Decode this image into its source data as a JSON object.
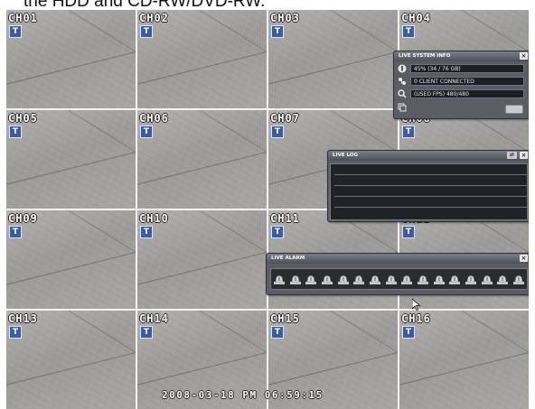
{
  "caption": "the HDD  and  CD-RW/DVD-RW.",
  "channels": [
    "CH01",
    "CH02",
    "CH03",
    "CH04",
    "CH05",
    "CH06",
    "CH07",
    "CH08",
    "CH09",
    "CH10",
    "CH11",
    "CH12",
    "CH13",
    "CH14",
    "CH15",
    "CH16"
  ],
  "channel_badge": "T",
  "live_system_info": {
    "title": "LIVE SYSTEM INFO",
    "close": "×",
    "rows": [
      {
        "icon": "hdd-info-icon",
        "value": "45% (34 / 76 GB)"
      },
      {
        "icon": "network-client-icon",
        "value": "0 CLIENT CONNECTED"
      },
      {
        "icon": "fps-search-icon",
        "value": "(USED FPS) 480/480"
      },
      {
        "icon": "backup-icon",
        "value": ""
      }
    ]
  },
  "live_log": {
    "title": "LIVE LOG",
    "restore": "⇄",
    "close": "×"
  },
  "live_alarm": {
    "title": "LIVE ALARM",
    "close": "×",
    "alarm_count": 16
  },
  "timestamp": "2008-03-18 PM 06:59:15",
  "colors": {
    "panel_bg": "#5a5d63",
    "badge_blue": "#3b5aa8"
  }
}
